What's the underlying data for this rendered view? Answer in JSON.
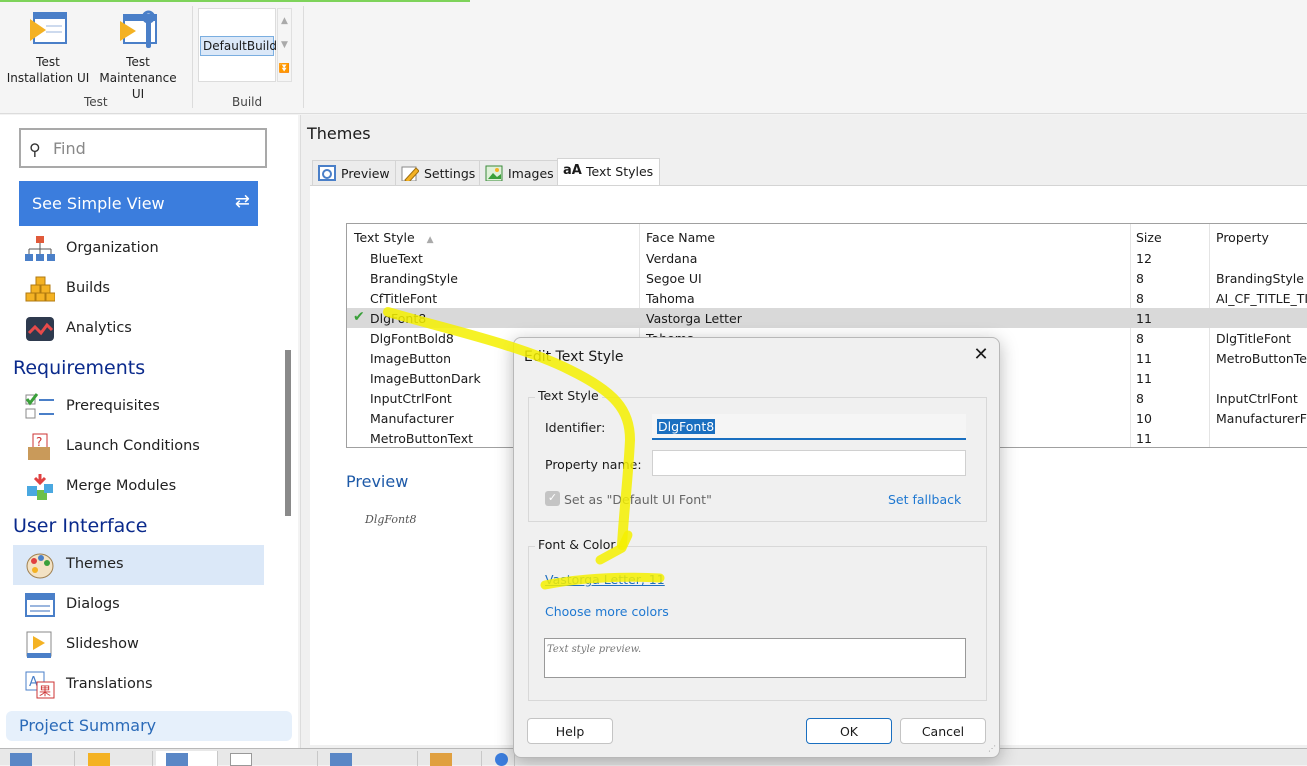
{
  "ribbon": {
    "test_install_label": "Test\nInstallation UI",
    "test_install_l1": "Test",
    "test_install_l2": "Installation UI",
    "test_maint_l1": "Test",
    "test_maint_l2": "Maintenance UI",
    "group_test": "Test",
    "build_value": "DefaultBuild",
    "group_build": "Build"
  },
  "sidebar": {
    "find_placeholder": "Find",
    "simple_view": "See Simple View",
    "items": [
      {
        "label": "Organization"
      },
      {
        "label": "Builds"
      },
      {
        "label": "Analytics"
      }
    ],
    "requirements_heading": "Requirements",
    "req_items": [
      {
        "label": "Prerequisites"
      },
      {
        "label": "Launch Conditions"
      },
      {
        "label": "Merge Modules"
      }
    ],
    "ui_heading": "User Interface",
    "ui_items": [
      {
        "label": "Themes",
        "selected": true
      },
      {
        "label": "Dialogs"
      },
      {
        "label": "Slideshow"
      },
      {
        "label": "Translations"
      }
    ],
    "project_summary": "Project Summary"
  },
  "main": {
    "title": "Themes",
    "tabs": [
      {
        "label": "Preview"
      },
      {
        "label": "Settings"
      },
      {
        "label": "Images"
      },
      {
        "label": "Text Styles",
        "active": true
      }
    ],
    "table": {
      "columns": [
        "Text Style",
        "Face Name",
        "Size",
        "Property"
      ],
      "rows": [
        {
          "style": "BlueText",
          "face": "Verdana",
          "size": "12",
          "property": ""
        },
        {
          "style": "BrandingStyle",
          "face": "Segoe UI",
          "size": "8",
          "property": "BrandingStyle"
        },
        {
          "style": "CfTitleFont",
          "face": "Tahoma",
          "size": "8",
          "property": "AI_CF_TITLE_TI"
        },
        {
          "style": "DlgFont8",
          "face": "Vastorga Letter",
          "size": "11",
          "property": "",
          "selected": true,
          "default": true
        },
        {
          "style": "DlgFontBold8",
          "face": "Tahoma",
          "size": "8",
          "property": "DlgTitleFont"
        },
        {
          "style": "ImageButton",
          "face": "",
          "size": "11",
          "property": "MetroButtonTex"
        },
        {
          "style": "ImageButtonDark",
          "face": "",
          "size": "11",
          "property": ""
        },
        {
          "style": "InputCtrlFont",
          "face": "",
          "size": "8",
          "property": "InputCtrlFont"
        },
        {
          "style": "Manufacturer",
          "face": "",
          "size": "10",
          "property": "ManufacturerFo"
        },
        {
          "style": "MetroButtonText",
          "face": "",
          "size": "11",
          "property": ""
        }
      ]
    },
    "preview_label": "Preview",
    "preview_sample": "DlgFont8"
  },
  "dialog": {
    "title": "Edit Text Style",
    "group_text_style": "Text Style",
    "identifier_label": "Identifier:",
    "identifier_value": "DlgFont8",
    "property_label": "Property name:",
    "property_value": "",
    "default_font_label": "Set as \"Default UI Font\"",
    "default_font_checked": true,
    "set_fallback": "Set fallback",
    "group_font_color": "Font & Color",
    "font_link": "Vastorga Letter, 11",
    "more_colors": "Choose more colors",
    "preview_text": "Text style preview.",
    "help": "Help",
    "ok": "OK",
    "cancel": "Cancel"
  },
  "colors": {
    "accent": "#3b7ddd",
    "highlight_annotation": "#f5f000",
    "selected_row": "#d9d9d9",
    "link": "#1f78d1"
  }
}
